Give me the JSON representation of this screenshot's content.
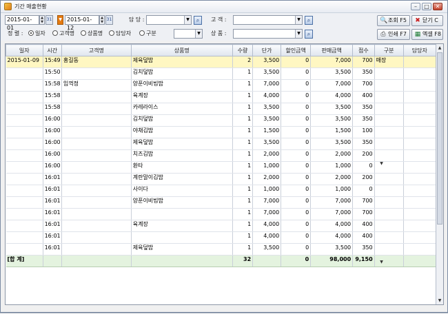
{
  "window": {
    "title": "기간 매출현황",
    "min": "–",
    "max": "□",
    "close": "✕"
  },
  "filters": {
    "date_from": "2015-01-01",
    "date_to": "2015-01-12",
    "staff_label": "담 당 :",
    "customer_label": "고 객 :",
    "product_label": "상 품 :",
    "sort_label": "정 렬 :",
    "staff_value": "",
    "customer_value": "",
    "product_value": "",
    "category_value": "",
    "sort_options": [
      {
        "label": "일자",
        "selected": true
      },
      {
        "label": "고객명",
        "selected": false
      },
      {
        "label": "상품명",
        "selected": false
      },
      {
        "label": "담당자",
        "selected": false
      },
      {
        "label": "구분",
        "selected": false
      }
    ]
  },
  "buttons": {
    "search": "조회 F5",
    "close": "닫기 C",
    "print": "인쇄 F7",
    "excel": "엑셀 F8"
  },
  "table": {
    "columns": [
      "일자",
      "시간",
      "고객명",
      "상품명",
      "수량",
      "단가",
      "할인금액",
      "판매금액",
      "점수",
      "구분",
      "담당자"
    ],
    "rows": [
      [
        "2015-01-09",
        "15:49",
        "홍길동",
        "제육덮밥",
        "2",
        "3,500",
        "0",
        "7,000",
        "700",
        "매장",
        ""
      ],
      [
        "",
        "15:50",
        "",
        "김치덮밥",
        "1",
        "3,500",
        "0",
        "3,500",
        "350",
        "",
        ""
      ],
      [
        "",
        "15:58",
        "임꺽정",
        "양푼이비빔밥",
        "1",
        "7,000",
        "0",
        "7,000",
        "700",
        "",
        ""
      ],
      [
        "",
        "15:58",
        "",
        "육계장",
        "1",
        "4,000",
        "0",
        "4,000",
        "400",
        "",
        ""
      ],
      [
        "",
        "15:58",
        "",
        "카레라이스",
        "1",
        "3,500",
        "0",
        "3,500",
        "350",
        "",
        ""
      ],
      [
        "",
        "16:00",
        "",
        "김치덮밥",
        "1",
        "3,500",
        "0",
        "3,500",
        "350",
        "",
        ""
      ],
      [
        "",
        "16:00",
        "",
        "야채김밥",
        "1",
        "1,500",
        "0",
        "1,500",
        "100",
        "",
        ""
      ],
      [
        "",
        "16:00",
        "",
        "제육덮밥",
        "1",
        "3,500",
        "0",
        "3,500",
        "350",
        "",
        ""
      ],
      [
        "",
        "16:00",
        "",
        "치즈김밥",
        "1",
        "2,000",
        "0",
        "2,000",
        "200",
        "",
        ""
      ],
      [
        "",
        "16:00",
        "",
        "환타",
        "1",
        "1,000",
        "0",
        "1,000",
        "0",
        "",
        ""
      ],
      [
        "",
        "16:01",
        "",
        "계란말이김밥",
        "1",
        "2,000",
        "0",
        "2,000",
        "200",
        "",
        ""
      ],
      [
        "",
        "16:01",
        "",
        "사이다",
        "1",
        "1,000",
        "0",
        "1,000",
        "0",
        "",
        ""
      ],
      [
        "",
        "16:01",
        "",
        "양푼이비빔밥",
        "1",
        "7,000",
        "0",
        "7,000",
        "700",
        "",
        ""
      ],
      [
        "",
        "16:01",
        "",
        "",
        "1",
        "7,000",
        "0",
        "7,000",
        "700",
        "",
        ""
      ],
      [
        "",
        "16:01",
        "",
        "육계장",
        "1",
        "4,000",
        "0",
        "4,000",
        "400",
        "",
        ""
      ],
      [
        "",
        "16:01",
        "",
        "",
        "1",
        "4,000",
        "0",
        "4,000",
        "400",
        "",
        ""
      ],
      [
        "",
        "16:01",
        "",
        "제육덮밥",
        "1",
        "3,500",
        "0",
        "3,500",
        "350",
        "",
        ""
      ]
    ],
    "total": {
      "label": "[합 계]",
      "qty": "32",
      "discount": "0",
      "sales": "98,000",
      "points": "9,150"
    }
  },
  "colors": {
    "selected_row": "#fff7c2",
    "total_row": "#e4f3df",
    "accent": "#e57a10"
  }
}
